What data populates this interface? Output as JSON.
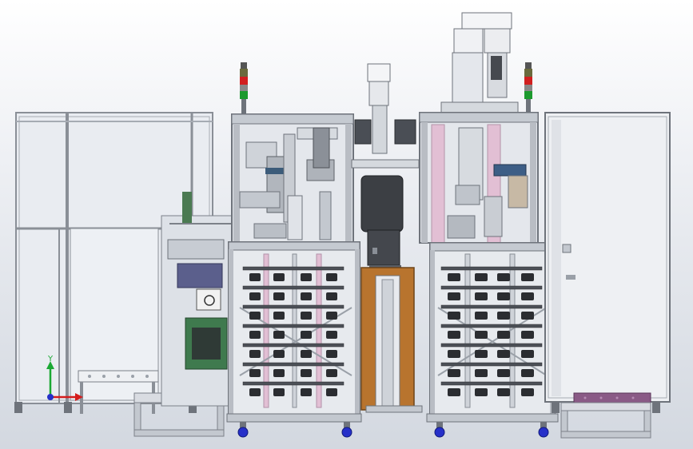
{
  "viewport": {
    "background_top": "#ffffff",
    "background_bottom": "#d3d8e0"
  },
  "colors": {
    "frame": "#b9bdc4",
    "frame_dark": "#6e737b",
    "steel": "#c7ccd3",
    "pink_guide": "#e2bfd4",
    "copper_panel": "#b8742e",
    "lamp_red": "#d11f1f",
    "lamp_amber": "#6a6a3c",
    "lamp_green": "#1c9a2e",
    "wheel_blue": "#2630c9",
    "dark_part": "#3c3f44",
    "purple_strip": "#8a5a86",
    "green_board": "#3f7a4e"
  },
  "axis_triad": {
    "y_label": "Y",
    "x_label": "",
    "y_color": "#1aa834",
    "x_color": "#d41d1d",
    "z_color": "#2430c8"
  },
  "icons": {
    "signal_tower_left": "signal-tower-icon",
    "signal_tower_right": "signal-tower-icon",
    "servo_motor_center": "servo-motor-icon",
    "servo_motor_right": "servo-motor-icon",
    "robot_arm": "robot-arm-icon"
  }
}
